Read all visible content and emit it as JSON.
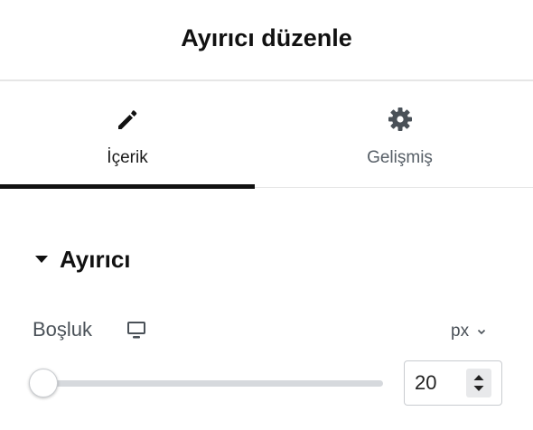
{
  "header": {
    "title": "Ayırıcı düzenle"
  },
  "tabs": [
    {
      "label": "İçerik",
      "icon": "pencil-icon",
      "active": true
    },
    {
      "label": "Gelişmiş",
      "icon": "gear-icon",
      "active": false
    }
  ],
  "section": {
    "title": "Ayırıcı",
    "expanded": true
  },
  "control": {
    "label": "Boşluk",
    "device": "desktop-icon",
    "unit": "px",
    "value": "20",
    "slider_fraction": 0.0
  },
  "colors": {
    "active_tab_underline": "#111111",
    "muted_text": "#565e66",
    "track": "#d6d9dd"
  }
}
